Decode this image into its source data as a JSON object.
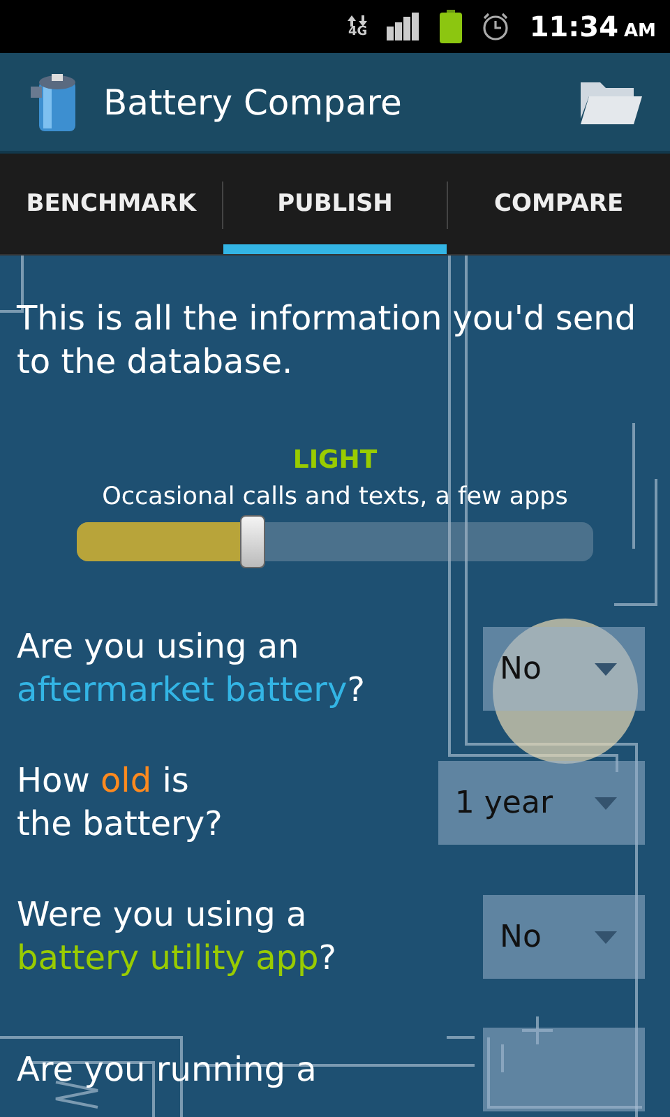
{
  "status_bar": {
    "network": "4G",
    "time": "11:34",
    "meridiem": "AM"
  },
  "action_bar": {
    "title": "Battery Compare"
  },
  "tabs": [
    {
      "label": "BENCHMARK",
      "selected": false
    },
    {
      "label": "PUBLISH",
      "selected": true
    },
    {
      "label": "COMPARE",
      "selected": false
    }
  ],
  "intro": "This is all the information you'd send to the database.",
  "usage_slider": {
    "label": "LIGHT",
    "description": "Occasional calls and texts, a few apps",
    "level": 0.34
  },
  "questions": [
    {
      "parts": [
        {
          "text": "Are you using an\n"
        },
        {
          "text": "aftermarket battery",
          "color": "#33b5e5"
        },
        {
          "text": "?"
        }
      ],
      "value": "No"
    },
    {
      "parts": [
        {
          "text": "How "
        },
        {
          "text": "old",
          "color": "#ff8a1f"
        },
        {
          "text": " is\nthe battery?"
        }
      ],
      "value": "1 year"
    },
    {
      "parts": [
        {
          "text": "Were you using a\n"
        },
        {
          "text": "battery utility app",
          "color": "#99cc00"
        },
        {
          "text": "?"
        }
      ],
      "value": "No"
    },
    {
      "parts": [
        {
          "text": "Are you running a"
        }
      ]
    }
  ]
}
